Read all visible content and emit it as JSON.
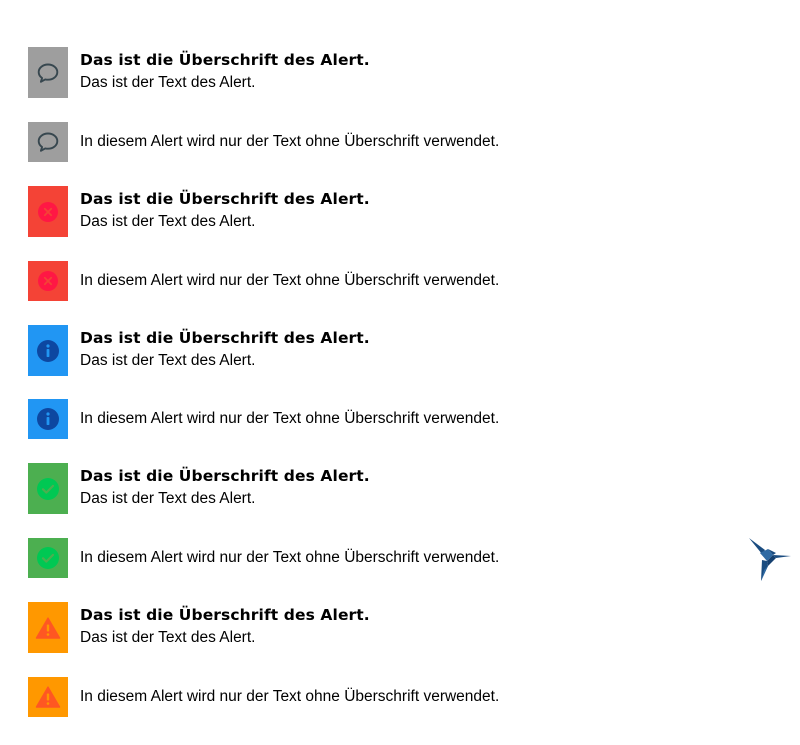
{
  "alerts": [
    {
      "variant": "default",
      "color": "#9e9e9e",
      "icon": "speech-bubble-icon",
      "headline": "Das ist die Überschrift des Alert.",
      "text": "Das ist der Text des Alert."
    },
    {
      "variant": "default",
      "color": "#9e9e9e",
      "icon": "speech-bubble-icon",
      "text": "In diesem Alert wird nur der Text ohne Überschrift verwendet."
    },
    {
      "variant": "error",
      "color": "#f44336",
      "icon": "error-x-icon",
      "headline": "Das ist die Überschrift des Alert.",
      "text": "Das ist der Text des Alert."
    },
    {
      "variant": "error",
      "color": "#f44336",
      "icon": "error-x-icon",
      "text": "In diesem Alert wird nur der Text ohne Überschrift verwendet."
    },
    {
      "variant": "info",
      "color": "#2196f3",
      "icon": "info-icon",
      "headline": "Das ist die Überschrift des Alert.",
      "text": "Das ist der Text des Alert."
    },
    {
      "variant": "info",
      "color": "#2196f3",
      "icon": "info-icon",
      "text": "In diesem Alert wird nur der Text ohne Überschrift verwendet."
    },
    {
      "variant": "success",
      "color": "#4caf50",
      "icon": "checkmark-icon",
      "headline": "Das ist die Überschrift des Alert.",
      "text": "Das ist der Text des Alert."
    },
    {
      "variant": "success",
      "color": "#4caf50",
      "icon": "checkmark-icon",
      "text": "In diesem Alert wird nur der Text ohne Überschrift verwendet."
    },
    {
      "variant": "warning",
      "color": "#ff9800",
      "icon": "warning-triangle-icon",
      "headline": "Das ist die Überschrift des Alert.",
      "text": "Das ist der Text des Alert."
    },
    {
      "variant": "warning",
      "color": "#ff9800",
      "icon": "warning-triangle-icon",
      "text": "In diesem Alert wird nur der Text ohne Überschrift verwendet."
    }
  ],
  "icon_colors": {
    "default": "#37474f",
    "error": "#ff1744",
    "info": "#0d47a1",
    "success": "#00c853",
    "warning": "#ff5722"
  },
  "logo": {
    "icon": "hummingbird-logo-icon",
    "color": "#1a4c80"
  }
}
